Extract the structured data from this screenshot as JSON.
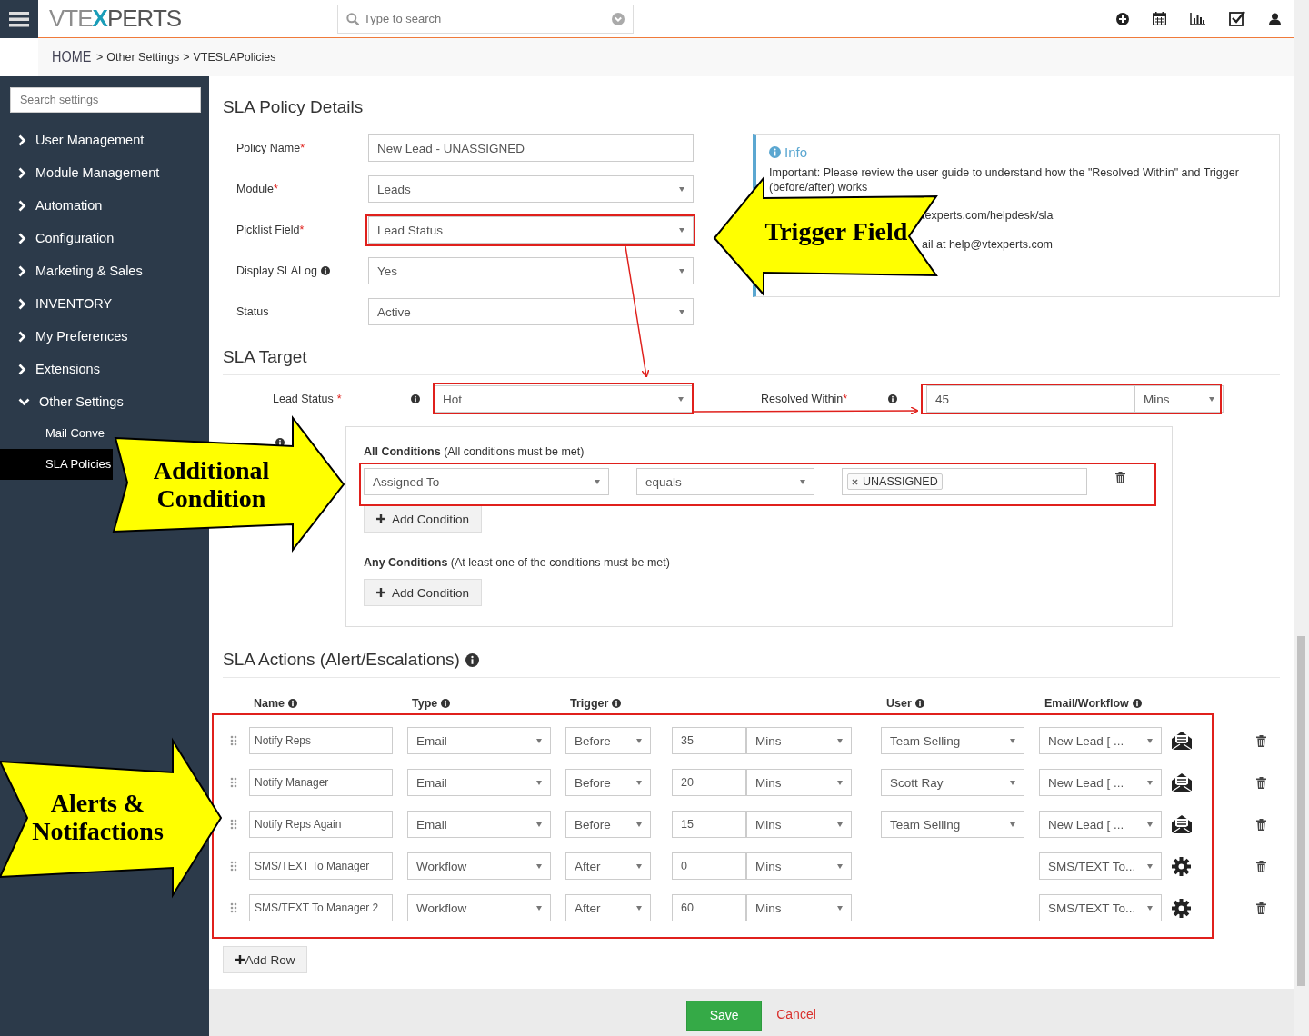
{
  "topbar": {
    "logo": [
      "VTE",
      "X",
      "PERTS"
    ],
    "search": {
      "placeholder": "Type to search"
    }
  },
  "breadcrumb": [
    {
      "kind": "home",
      "text": "HOME"
    },
    {
      "kind": "sep",
      "text": ">"
    },
    {
      "kind": "link",
      "text": "Other Settings"
    },
    {
      "kind": "sep",
      "text": ">"
    },
    {
      "kind": "current",
      "text": "VTESLAPolicies"
    }
  ],
  "sidebar": {
    "search": {
      "placeholder": "Search settings"
    },
    "items": [
      {
        "label": "User Management",
        "expanded": false
      },
      {
        "label": "Module Management",
        "expanded": false
      },
      {
        "label": "Automation",
        "expanded": false
      },
      {
        "label": "Configuration",
        "expanded": false
      },
      {
        "label": "Marketing & Sales",
        "expanded": false
      },
      {
        "label": "INVENTORY",
        "expanded": false
      },
      {
        "label": "My Preferences",
        "expanded": false
      },
      {
        "label": "Extensions",
        "expanded": false
      },
      {
        "label": "Other Settings",
        "expanded": true,
        "children": [
          {
            "label": "Mail Conve",
            "selected": false
          },
          {
            "label": "SLA Policies",
            "selected": true
          }
        ]
      }
    ]
  },
  "details": {
    "title": "SLA Policy Details",
    "fields": [
      {
        "label": "Policy Name",
        "marker": "*",
        "kind": "text",
        "value": "New Lead - UNASSIGNED"
      },
      {
        "label": "Module",
        "marker": "*",
        "kind": "select",
        "value": "Leads"
      },
      {
        "label": "Picklist Field",
        "marker": "*",
        "kind": "select",
        "value": "Lead Status"
      },
      {
        "label": "Display SLALog",
        "info": true,
        "kind": "select",
        "value": "Yes"
      },
      {
        "label": "Status",
        "kind": "select",
        "value": "Active"
      }
    ],
    "info": {
      "title": "Info",
      "text": "Important: Please review the user guide to understand how the \"Resolved Within\" and Trigger (before/after) works",
      "lines": [
        "texperts.com/helpdesk/sla",
        "ail at help@vtexperts.com"
      ]
    }
  },
  "target": {
    "title": "SLA Target",
    "status_label": "Lead Status",
    "status_marker": "*",
    "status_value": "Hot",
    "resolved_label": "Resolved Within",
    "resolved_marker": "*",
    "resolved_value": "45",
    "resolved_unit": "Mins",
    "all": {
      "title": "All Conditions",
      "note": "(All conditions must be met)",
      "conditions": [
        {
          "field": "Assigned To",
          "operator": "equals",
          "values": [
            "UNASSIGNED"
          ]
        }
      ],
      "add": "Add Condition"
    },
    "any": {
      "title": "Any Conditions",
      "note": "(At least one of the conditions must be met)",
      "add": "Add Condition"
    }
  },
  "actions": {
    "title": "SLA Actions (Alert/Escalations)",
    "columns": [
      "Name",
      "Type",
      "Trigger",
      "User",
      "Email/Workflow"
    ],
    "rows": [
      {
        "name": "Notify Reps",
        "type": "Email",
        "trigger": "Before",
        "amount": "35",
        "unit": "Mins",
        "user": "Team Selling",
        "target": "New Lead [ ...",
        "kind": "email"
      },
      {
        "name": "Notify Manager",
        "type": "Email",
        "trigger": "Before",
        "amount": "20",
        "unit": "Mins",
        "user": "Scott Ray",
        "target": "New Lead [ ...",
        "kind": "email"
      },
      {
        "name": "Notify Reps Again",
        "type": "Email",
        "trigger": "Before",
        "amount": "15",
        "unit": "Mins",
        "user": "Team Selling",
        "target": "New Lead [ ...",
        "kind": "email"
      },
      {
        "name": "SMS/TEXT To Manager",
        "type": "Workflow",
        "trigger": "After",
        "amount": "0",
        "unit": "Mins",
        "target": "SMS/TEXT To...",
        "kind": "workflow"
      },
      {
        "name": "SMS/TEXT To Manager 2",
        "type": "Workflow",
        "trigger": "After",
        "amount": "60",
        "unit": "Mins",
        "target": "SMS/TEXT To...",
        "kind": "workflow"
      }
    ],
    "add_row": "Add Row"
  },
  "footer": {
    "save": "Save",
    "cancel": "Cancel"
  },
  "annotations": [
    {
      "kind": "left",
      "text": "Trigger Field"
    },
    {
      "kind": "right",
      "text": "Additional Condition"
    },
    {
      "kind": "right",
      "text": "Alerts & Notifactions"
    }
  ]
}
